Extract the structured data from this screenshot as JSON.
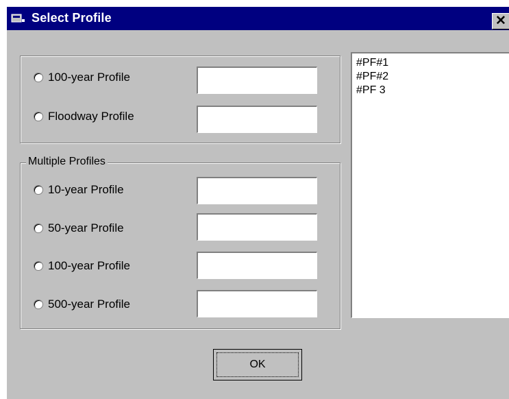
{
  "window": {
    "title": "Select Profile",
    "close_glyph": "✕"
  },
  "single_profiles": {
    "items": [
      {
        "label": "100-year Profile",
        "value": ""
      },
      {
        "label": "Floodway Profile",
        "value": ""
      }
    ]
  },
  "multiple_profiles": {
    "legend": "Multiple Profiles",
    "items": [
      {
        "label": "10-year Profile",
        "value": ""
      },
      {
        "label": "50-year Profile",
        "value": ""
      },
      {
        "label": "100-year Profile",
        "value": ""
      },
      {
        "label": "500-year Profile",
        "value": ""
      }
    ]
  },
  "profile_list": {
    "items": [
      "#PF#1",
      "#PF#2",
      "#PF 3"
    ]
  },
  "ok_button": {
    "label": "OK"
  },
  "colors": {
    "titlebar": "#000080",
    "face": "#c0c0c0"
  },
  "icons": {
    "title": "window-app-icon",
    "close": "close-icon"
  }
}
